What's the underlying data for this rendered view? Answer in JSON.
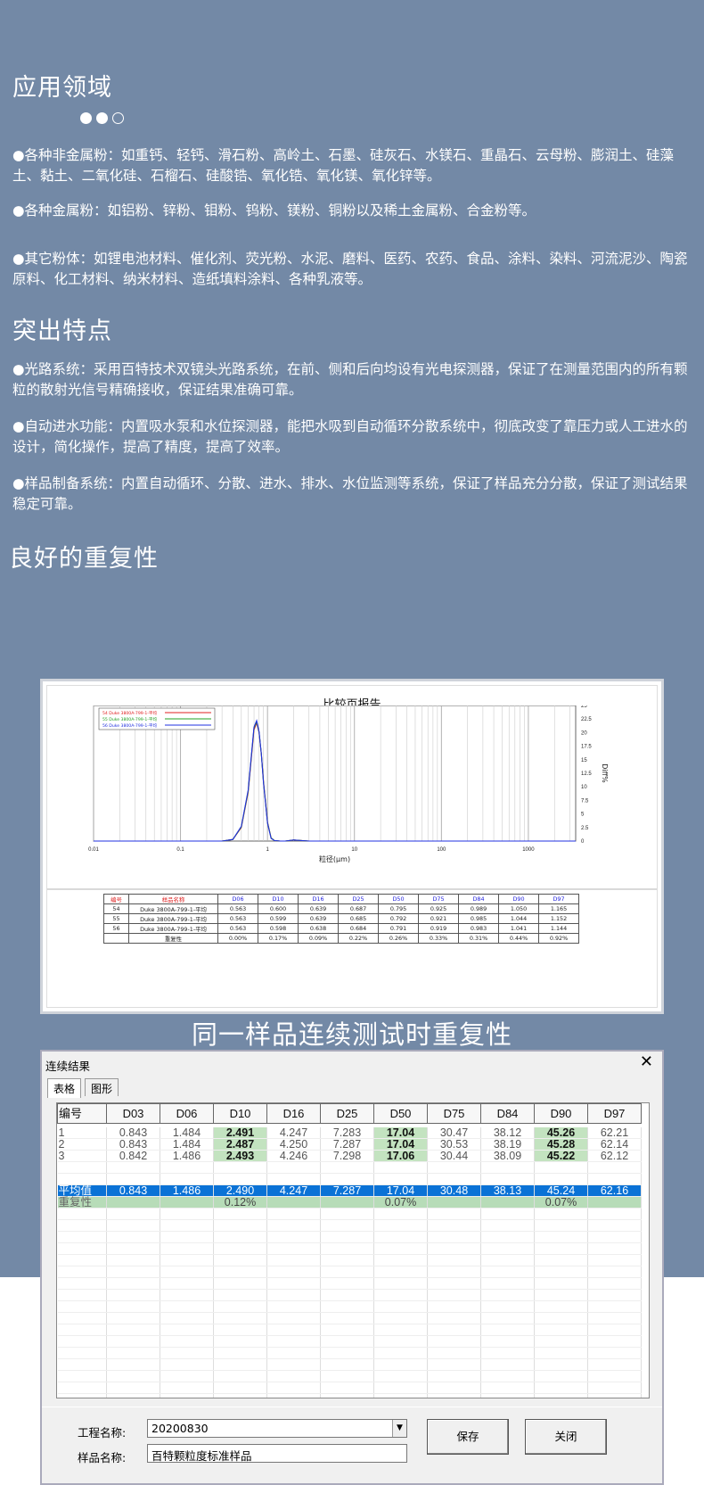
{
  "sections": {
    "applications": {
      "title": "应用领域",
      "p1": "●各种非金属粉：如重钙、轻钙、滑石粉、高岭土、石墨、硅灰石、水镁石、重晶石、云母粉、膨润土、硅藻土、黏土、二氧化硅、石榴石、硅酸锆、氧化锆、氧化镁、氧化锌等。",
      "p2": "●各种金属粉：如铝粉、锌粉、钼粉、钨粉、镁粉、铜粉以及稀土金属粉、合金粉等。",
      "p3": "●其它粉体：如锂电池材料、催化剂、荧光粉、水泥、磨料、医药、农药、食品、涂料、染料、河流泥沙、陶瓷原料、化工材料、纳米材料、造纸填料涂料、各种乳液等。"
    },
    "features": {
      "title": "突出特点",
      "p1": "●光路系统：采用百特技术双镜头光路系统，在前、侧和后向均设有光电探测器，保证了在测量范围内的所有颗粒的散射光信号精确接收，保证结果准确可靠。",
      "p2": "●自动进水功能：内置吸水泵和水位探测器，能把水吸到自动循环分散系统中，彻底改变了靠压力或人工进水的设计，简化操作，提高了精度，提高了效率。",
      "p3": "●样品制备系统：内置自动循环、分散、进水、排水、水位监测等系统，保证了样品充分分散，保证了测试结果稳定可靠。"
    },
    "repeatability": {
      "title": "良好的重复性"
    }
  },
  "report": {
    "title": "比较页报告",
    "headers": [
      "编号",
      "样品名称",
      "D06",
      "D10",
      "D16",
      "D25",
      "D50",
      "D75",
      "D84",
      "D90",
      "D97"
    ],
    "rows": [
      [
        "54",
        "Duke 3800A-799-1-平均",
        "0.563",
        "0.600",
        "0.639",
        "0.687",
        "0.795",
        "0.925",
        "0.989",
        "1.050",
        "1.165"
      ],
      [
        "55",
        "Duke 3800A-799-1-平均",
        "0.563",
        "0.599",
        "0.639",
        "0.685",
        "0.792",
        "0.921",
        "0.985",
        "1.044",
        "1.152"
      ],
      [
        "56",
        "Duke 3800A-799-1-平均",
        "0.563",
        "0.598",
        "0.638",
        "0.684",
        "0.791",
        "0.919",
        "0.983",
        "1.041",
        "1.144"
      ],
      [
        "",
        "重复性",
        "0.00%",
        "0.17%",
        "0.09%",
        "0.22%",
        "0.26%",
        "0.33%",
        "0.31%",
        "0.44%",
        "0.92%"
      ]
    ]
  },
  "chart_data": {
    "type": "line",
    "xlabel": "粒径(μm)",
    "ylabel": "Diff%",
    "xscale": "log",
    "xlim": [
      0.01,
      3500
    ],
    "ylim": [
      0,
      25
    ],
    "xticks": [
      "0.01",
      "0.1",
      "1",
      "10",
      "100",
      "1000"
    ],
    "yticks": [
      "0",
      "2.5",
      "5",
      "7.5",
      "10",
      "12.5",
      "15",
      "17.5",
      "20",
      "22.5",
      "25"
    ],
    "grid": true,
    "legend_position": "top-left",
    "series": [
      {
        "name": "54  Duke 3800A-799-1-平均",
        "color": "#e02020",
        "x": [
          0.3,
          0.4,
          0.5,
          0.6,
          0.65,
          0.7,
          0.75,
          0.8,
          0.85,
          0.9,
          1.0,
          1.1,
          1.2,
          1.4,
          1.6,
          2.0,
          3.0
        ],
        "y": [
          0,
          0.3,
          2.5,
          9,
          15,
          20.5,
          21.8,
          20,
          16,
          11,
          3.5,
          0.6,
          0.1,
          0,
          0,
          0.2,
          0
        ]
      },
      {
        "name": "55  Duke 3800A-799-1-平均",
        "color": "#20a020",
        "x": [
          0.3,
          0.4,
          0.5,
          0.6,
          0.65,
          0.7,
          0.75,
          0.8,
          0.85,
          0.9,
          1.0,
          1.1,
          1.2,
          1.4,
          1.6,
          2.0,
          3.0
        ],
        "y": [
          0,
          0.3,
          2.6,
          9.2,
          15.3,
          20.8,
          22,
          20.1,
          16,
          10.8,
          3.4,
          0.6,
          0.1,
          0,
          0,
          0.2,
          0
        ]
      },
      {
        "name": "56  Duke 3800A-799-1-平均",
        "color": "#2030e0",
        "x": [
          0.3,
          0.4,
          0.5,
          0.6,
          0.65,
          0.7,
          0.75,
          0.8,
          0.85,
          0.9,
          1.0,
          1.1,
          1.2,
          1.4,
          1.6,
          2.0,
          3.0
        ],
        "y": [
          0,
          0.3,
          2.7,
          9.4,
          15.5,
          21,
          22.2,
          20.2,
          16,
          10.7,
          3.3,
          0.5,
          0.1,
          0,
          0,
          0.2,
          0
        ]
      }
    ]
  },
  "caption": "同一样品连续测试时重复性",
  "window": {
    "title": "连续结果",
    "close": "✕",
    "tabs": [
      "表格",
      "图形"
    ],
    "headers": [
      "编号",
      "D03",
      "D06",
      "D10",
      "D16",
      "D25",
      "D50",
      "D75",
      "D84",
      "D90",
      "D97"
    ],
    "rows": [
      [
        "1",
        "0.843",
        "1.484",
        "2.491",
        "4.247",
        "7.283",
        "17.04",
        "30.47",
        "38.12",
        "45.26",
        "62.21"
      ],
      [
        "2",
        "0.843",
        "1.484",
        "2.487",
        "4.250",
        "7.287",
        "17.04",
        "30.53",
        "38.19",
        "45.28",
        "62.14"
      ],
      [
        "3",
        "0.842",
        "1.486",
        "2.493",
        "4.246",
        "7.298",
        "17.06",
        "30.44",
        "38.09",
        "45.22",
        "62.12"
      ]
    ],
    "avg": [
      "平均值",
      "0.843",
      "1.486",
      "2.490",
      "4.247",
      "7.287",
      "17.04",
      "30.48",
      "38.13",
      "45.24",
      "62.16"
    ],
    "rep": [
      "重复性",
      "",
      "",
      "0.12%",
      "",
      "",
      "0.07%",
      "",
      "",
      "0.07%",
      ""
    ],
    "project_label": "工程名称:",
    "project_value": "20200830",
    "sample_label": "样品名称:",
    "sample_value": "百特颗粒度标准样品",
    "save": "保存",
    "close_btn": "关闭"
  }
}
